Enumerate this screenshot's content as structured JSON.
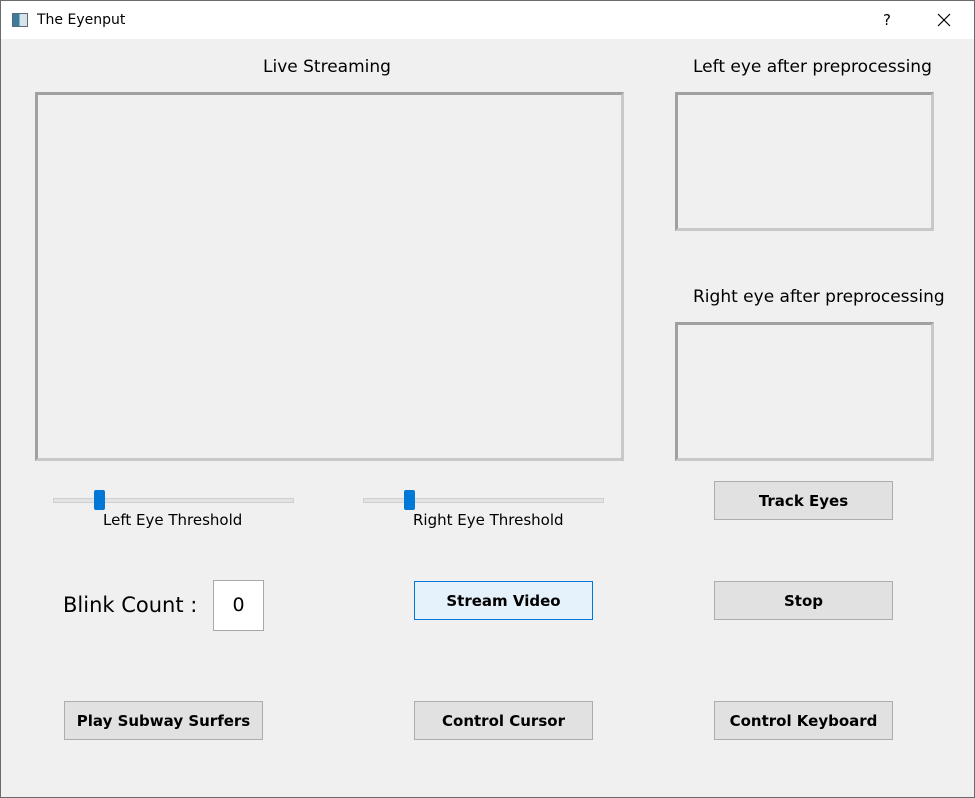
{
  "window": {
    "title": "The Eyenput",
    "help_label": "?"
  },
  "panels": {
    "live_streaming_label": "Live Streaming",
    "left_eye_label": "Left eye after preprocessing",
    "right_eye_label": "Right eye after preprocessing"
  },
  "sliders": {
    "left": {
      "label": "Left Eye Threshold",
      "value_fraction": 0.18
    },
    "right": {
      "label": "Right Eye Threshold",
      "value_fraction": 0.18
    }
  },
  "blink": {
    "label": "Blink Count :",
    "value": "0"
  },
  "buttons": {
    "track_eyes": "Track Eyes",
    "stream_video": "Stream Video",
    "stop": "Stop",
    "play_subway_surfers": "Play Subway Surfers",
    "control_cursor": "Control Cursor",
    "control_keyboard": "Control Keyboard"
  },
  "colors": {
    "accent": "#0078d7",
    "window_bg": "#f0f0f0",
    "button_bg": "#e1e1e1",
    "focused_button_bg": "#e5f1fb"
  }
}
